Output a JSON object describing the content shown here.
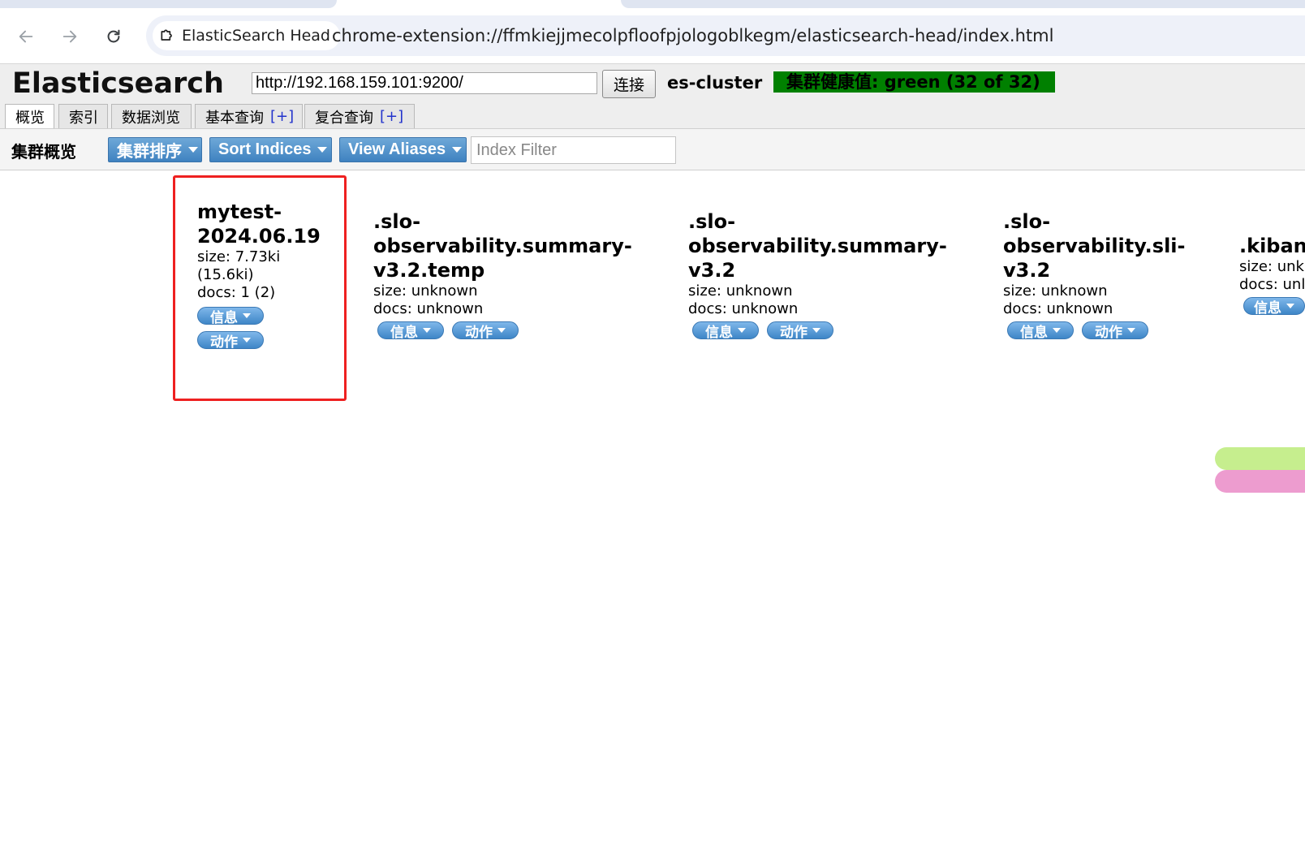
{
  "browser": {
    "site_chip_label": "ElasticSearch Head",
    "url": "chrome-extension://ffmkiejjmecolpfloofpjologoblkegm/elasticsearch-head/index.html"
  },
  "header": {
    "title": "Elasticsearch",
    "cluster_url": "http://192.168.159.101:9200/",
    "connect_label": "连接",
    "cluster_name": "es-cluster",
    "health_text": "集群健康值: green (32 of 32)",
    "health_color": "#008000",
    "tabs": [
      {
        "label": "概览",
        "active": true
      },
      {
        "label": "索引"
      },
      {
        "label": "数据浏览"
      },
      {
        "label": "基本查询",
        "plus": "[+]"
      },
      {
        "label": "复合查询",
        "plus": "[+]"
      }
    ]
  },
  "subbar": {
    "title": "集群概览",
    "sort_cluster_label": "集群排序",
    "sort_indices_label": "Sort Indices",
    "view_aliases_label": "View Aliases",
    "filter_placeholder": "Index Filter"
  },
  "indices": [
    {
      "name_line1": "mytest-",
      "name_line2": "2024.06.19",
      "size_line1": "size: 7.73ki",
      "size_line2": "(15.6ki)",
      "docs": "docs: 1 (2)",
      "info_label": "信息",
      "action_label": "动作"
    },
    {
      "name_line1": ".slo-",
      "name_line2": "observability.summary-",
      "name_line3": "v3.2.temp",
      "size": "size: unknown",
      "docs": "docs: unknown",
      "info_label": "信息",
      "action_label": "动作"
    },
    {
      "name_line1": ".slo-",
      "name_line2": "observability.summary-",
      "name_line3": "v3.2",
      "size": "size: unknown",
      "docs": "docs: unknown",
      "info_label": "信息",
      "action_label": "动作"
    },
    {
      "name_line1": ".slo-",
      "name_line2": "observability.sli-",
      "name_line3": "v3.2",
      "size": "size: unknown",
      "docs": "docs: unknown",
      "info_label": "信息",
      "action_label": "动作"
    },
    {
      "name_line1": ".kiban",
      "size": "size: unk",
      "docs": "docs: unl",
      "info_label": "信息"
    }
  ],
  "colors": {
    "accent_button": "#3f82c0",
    "highlight_border": "#ee2020",
    "marker_green": "#c6ee8e",
    "marker_pink": "#ed9ccf"
  }
}
